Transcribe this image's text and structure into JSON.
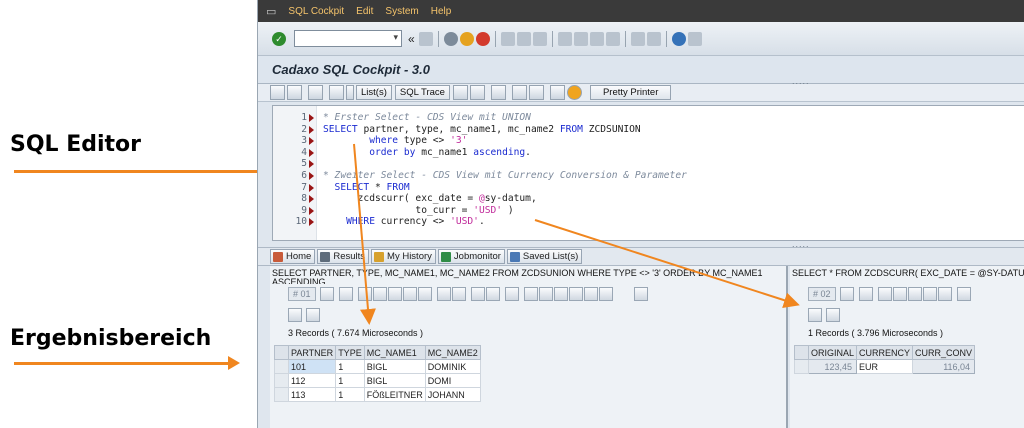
{
  "annotations": {
    "sql_editor": "SQL Editor",
    "results_area": "Ergebnisbereich",
    "arrow_color": "#f0861f"
  },
  "menubar": {
    "window_icon": "window-icon",
    "items": [
      "SQL Cockpit",
      "Edit",
      "System",
      "Help"
    ]
  },
  "system_toolbar": {
    "command_field_value": "",
    "collapse_symbol": "«"
  },
  "title": "Cadaxo SQL Cockpit - 3.0",
  "app_toolbar": {
    "list_button": "List(s)",
    "sql_trace_button": "SQL Trace",
    "pretty_printer_button": "Pretty Printer"
  },
  "editor": {
    "lines": [
      {
        "n": "1",
        "tokens": [
          {
            "c": "comment",
            "t": "* Erster Select - CDS View mit UNION"
          }
        ]
      },
      {
        "n": "2",
        "tokens": [
          {
            "c": "kw",
            "t": "SELECT "
          },
          {
            "c": "id",
            "t": "partner, type, mc_name1, mc_name2 "
          },
          {
            "c": "kw",
            "t": "FROM "
          },
          {
            "c": "id",
            "t": "ZCDSUNION"
          }
        ]
      },
      {
        "n": "3",
        "tokens": [
          {
            "c": "kw",
            "t": "        where "
          },
          {
            "c": "id",
            "t": "type <> "
          },
          {
            "c": "str",
            "t": "'3'"
          }
        ]
      },
      {
        "n": "4",
        "tokens": [
          {
            "c": "kw",
            "t": "        order by "
          },
          {
            "c": "id",
            "t": "mc_name1 "
          },
          {
            "c": "kw",
            "t": "ascending"
          },
          {
            "c": "id",
            "t": "."
          }
        ]
      },
      {
        "n": "5",
        "tokens": []
      },
      {
        "n": "6",
        "tokens": [
          {
            "c": "comment",
            "t": "* Zweiter Select - CDS View mit Currency Conversion & Parameter"
          }
        ]
      },
      {
        "n": "7",
        "tokens": [
          {
            "c": "kw",
            "t": "  SELECT "
          },
          {
            "c": "id",
            "t": "* "
          },
          {
            "c": "kw",
            "t": "FROM"
          }
        ]
      },
      {
        "n": "8",
        "tokens": [
          {
            "c": "id",
            "t": "      zcdscurr( exc_date = "
          },
          {
            "c": "at",
            "t": "@"
          },
          {
            "c": "id",
            "t": "sy-datum,"
          }
        ]
      },
      {
        "n": "9",
        "tokens": [
          {
            "c": "id",
            "t": "                to_curr = "
          },
          {
            "c": "str",
            "t": "'USD'"
          },
          {
            "c": "id",
            "t": " )"
          }
        ]
      },
      {
        "n": "10",
        "tokens": [
          {
            "c": "kw",
            "t": "    WHERE "
          },
          {
            "c": "id",
            "t": "currency <> "
          },
          {
            "c": "str",
            "t": "'USD'"
          },
          {
            "c": "id",
            "t": "."
          }
        ]
      }
    ]
  },
  "tabs": [
    "Home",
    "Results",
    "My History",
    "Jobmonitor",
    "Saved List(s)"
  ],
  "results_left": {
    "sql": "SELECT PARTNER, TYPE, MC_NAME1, MC_NAME2 FROM ZCDSUNION WHERE TYPE <> '3' ORDER BY MC_NAME1",
    "sql_cont": "ASCENDING",
    "result_no": "# 01",
    "records": "3 Records ( 7.674 Microseconds )",
    "columns": [
      "PARTNER",
      "TYPE",
      "MC_NAME1",
      "MC_NAME2"
    ],
    "rows": [
      [
        "101",
        "1",
        "BIGL",
        "DOMINIK"
      ],
      [
        "112",
        "1",
        "BIGL",
        "DOMI"
      ],
      [
        "113",
        "1",
        "FÖßLEITNER",
        "JOHANN"
      ]
    ]
  },
  "results_right": {
    "sql": "SELECT * FROM ZCDSCURR( EXC_DATE = @SY-DATUM, T",
    "result_no": "# 02",
    "records": "1 Records ( 3.796 Microseconds )",
    "columns": [
      "ORIGINAL",
      "CURRENCY",
      "CURR_CONV"
    ],
    "rows": [
      [
        "123,45",
        "EUR",
        "116,04"
      ]
    ]
  }
}
